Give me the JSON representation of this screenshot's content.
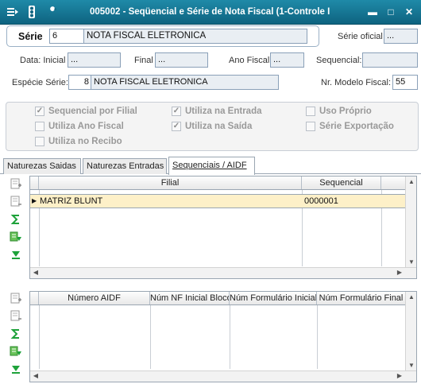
{
  "window": {
    "title": "005002 - Seqüencial e Série de Nota Fiscal (1-Controle I",
    "minimize": "▬",
    "maximize": "□",
    "close": "✕"
  },
  "header": {
    "serie_label": "Série",
    "serie_code": "6",
    "serie_desc": "NOTA FISCAL ELETRONICA",
    "serie_oficial_label": "Série oficial",
    "serie_oficial_value": "...",
    "data_inicial_label": "Data: Inicial",
    "data_inicial_value": "...",
    "final_label": "Final",
    "final_value": "...",
    "ano_fiscal_label": "Ano Fiscal:",
    "ano_fiscal_value": "...",
    "sequencial_label": "Sequencial:",
    "sequencial_value": "",
    "especie_label": "Espécie Série:",
    "especie_code": "8",
    "especie_desc": "NOTA FISCAL ELETRONICA",
    "modelo_label": "Nr. Modelo Fiscal:",
    "modelo_value": "55"
  },
  "options": [
    {
      "label": "Sequencial por Filial",
      "checked": true
    },
    {
      "label": "Utiliza Ano Fiscal",
      "checked": false
    },
    {
      "label": "Utiliza no Recibo",
      "checked": false
    },
    {
      "label": "Utiliza na Entrada",
      "checked": true
    },
    {
      "label": "Utiliza na Saída",
      "checked": true
    },
    {
      "label": "Uso Próprio",
      "checked": false
    },
    {
      "label": "Série Exportação",
      "checked": false
    }
  ],
  "tabs": [
    {
      "label": "Naturezas Saidas",
      "active": false
    },
    {
      "label": "Naturezas Entradas",
      "active": false
    },
    {
      "label": "Sequenciais / AIDF",
      "active": true
    }
  ],
  "grid1": {
    "columns": [
      "Filial",
      "Sequencial"
    ],
    "rows": [
      {
        "filial": "MATRIZ BLUNT",
        "sequencial": "0000001"
      }
    ]
  },
  "grid2": {
    "columns": [
      "Número AIDF",
      "Núm NF Inicial Bloco",
      "Núm Formulário Inicial",
      "Núm Formulário Final"
    ],
    "rows": []
  },
  "colors": {
    "titlebar": "#1a7f9e",
    "selected_row": "#fdf0c8",
    "sum_icon": "#1ea23a"
  }
}
